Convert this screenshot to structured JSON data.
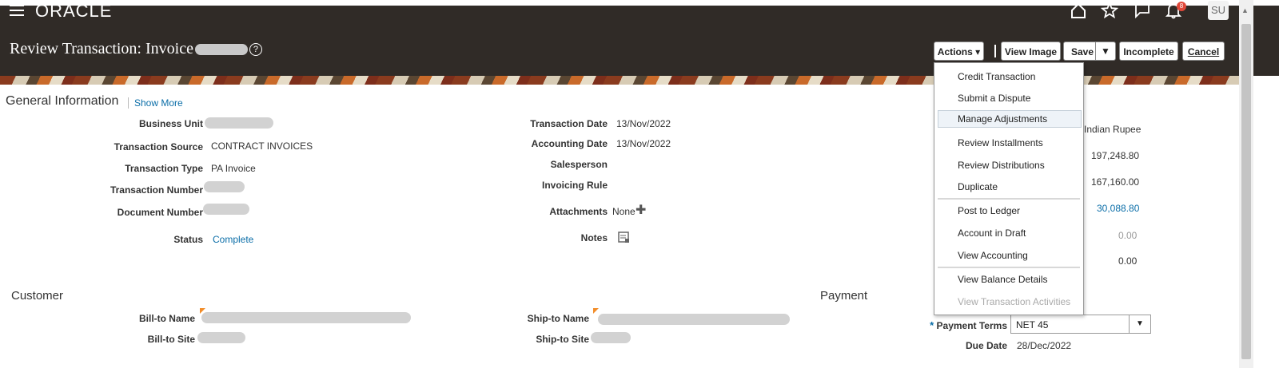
{
  "header": {
    "brand": "ORACLE",
    "avatar_initials": "SU",
    "notification_count": "8",
    "page_title": "Review Transaction: Invoice",
    "help_glyph": "?",
    "buttons": {
      "actions": "Actions",
      "view_image": "View Image",
      "save": "Save",
      "incomplete": "Incomplete",
      "cancel": "Cancel"
    },
    "icons": [
      "menu-icon",
      "home-icon",
      "star-icon",
      "flag-icon",
      "bell-icon"
    ]
  },
  "general": {
    "title": "General Information",
    "show_more": "Show More",
    "left": {
      "business_unit_label": "Business Unit",
      "transaction_source_label": "Transaction Source",
      "transaction_source_value": "CONTRACT INVOICES",
      "transaction_type_label": "Transaction Type",
      "transaction_type_value": "PA Invoice",
      "transaction_number_label": "Transaction Number",
      "document_number_label": "Document Number",
      "status_label": "Status",
      "status_value": "Complete"
    },
    "middle": {
      "transaction_date_label": "Transaction Date",
      "transaction_date_value": "13/Nov/2022",
      "accounting_date_label": "Accounting Date",
      "accounting_date_value": "13/Nov/2022",
      "salesperson_label": "Salesperson",
      "invoicing_rule_label": "Invoicing Rule",
      "attachments_label": "Attachments",
      "attachments_value": "None",
      "notes_label": "Notes"
    },
    "right": {
      "currency": "Indian Rupee",
      "amount1": "197,248.80",
      "amount2": "167,160.00",
      "amount3": "30,088.80",
      "amount4": "0.00",
      "amount5": "0.00"
    }
  },
  "actions_menu": {
    "items": [
      "Credit Transaction",
      "Submit a Dispute",
      "Manage Adjustments",
      "Review Installments",
      "Review Distributions",
      "Duplicate",
      "Post to Ledger",
      "Account in Draft",
      "View Accounting",
      "View Balance Details",
      "View Transaction Activities"
    ],
    "highlighted": "Manage Adjustments",
    "disabled": "View Transaction Activities"
  },
  "customer": {
    "title": "Customer",
    "bill_to_name_label": "Bill-to Name",
    "bill_to_site_label": "Bill-to Site",
    "ship_to_name_label": "Ship-to Name",
    "ship_to_site_label": "Ship-to Site"
  },
  "payment": {
    "title": "Payment",
    "required_marker": "*",
    "payment_terms_label": "Payment Terms",
    "payment_terms_value": "NET 45",
    "due_date_label": "Due Date",
    "due_date_value": "28/Dec/2022"
  }
}
